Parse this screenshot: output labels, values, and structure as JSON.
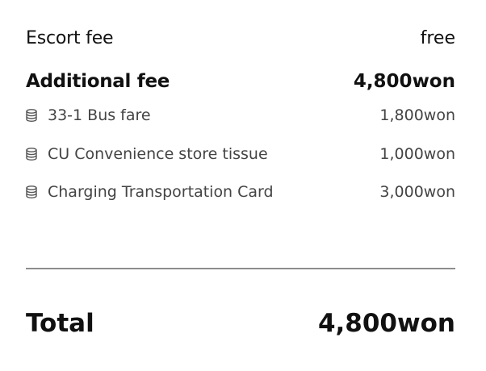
{
  "escort": {
    "label": "Escort fee",
    "value": "free"
  },
  "additional": {
    "label": "Additional fee",
    "value": "4,800won"
  },
  "items": [
    {
      "icon": "coin-stack-icon",
      "label": "33-1 Bus fare",
      "value": "1,800won"
    },
    {
      "icon": "coin-stack-icon",
      "label": "CU Convenience store tissue",
      "value": "1,000won"
    },
    {
      "icon": "coin-stack-icon",
      "label": "Charging Transportation Card",
      "value": "3,000won"
    }
  ],
  "total": {
    "label": "Total",
    "value": "4,800won"
  },
  "colors": {
    "text": "#111111",
    "subtext": "#444444",
    "divider": "#8e8e8e"
  }
}
